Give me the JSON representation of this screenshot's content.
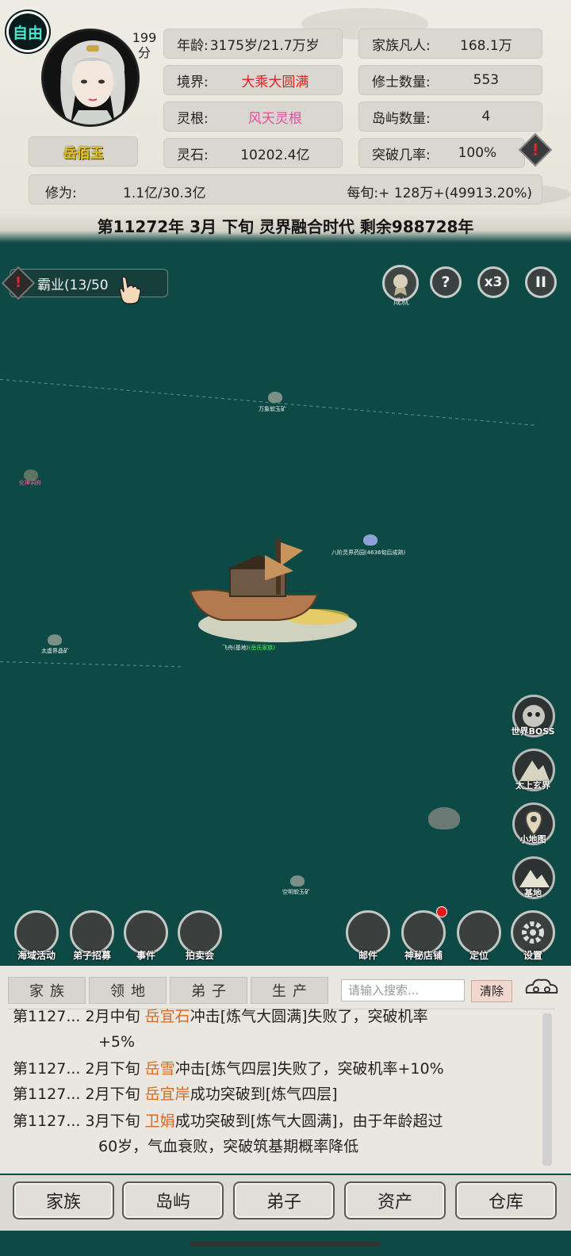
{
  "header": {
    "free_badge": "自由",
    "score_value": "199",
    "score_unit": "分",
    "character_name": "岳佰玉",
    "stats_left": [
      {
        "key": "年龄:",
        "value": "3175岁/21.7万岁",
        "color": "#222222"
      },
      {
        "key": "境界:",
        "value": "大乘大圆满",
        "color": "#e02020"
      },
      {
        "key": "灵根:",
        "value": "风天灵根",
        "color": "#e050a0"
      },
      {
        "key": "灵石:",
        "value": "10202.4亿",
        "color": "#222222"
      }
    ],
    "stats_right": [
      {
        "key": "家族凡人:",
        "value": "168.1万"
      },
      {
        "key": "修士数量:",
        "value": "553"
      },
      {
        "key": "岛屿数量:",
        "value": "4"
      },
      {
        "key": "突破几率:",
        "value": "100%"
      }
    ],
    "cultivation": {
      "key": "修为:",
      "value": "1.1亿/30.3亿",
      "rate": "每旬:+ 128万+(49913.20%)"
    },
    "warn_icon": "!"
  },
  "status_line": "第11272年 3月 下旬  灵界融合时代 剩余988728年",
  "map": {
    "quest_label": "霸业(13/50",
    "quest_warn": "!",
    "achievement_label": "成就",
    "help_label": "?",
    "speed_label": "x3",
    "pause_label": "II",
    "labels": {
      "mine1": "万象软玉矿",
      "farm": "八阶灵界药园(4636旬后成熟)",
      "mine2": "太虚界晶矿",
      "ship": "飞舟(基地)",
      "ship_owner": "(岳氏家族)",
      "mine3": "空明软玉矿",
      "island": "化神洞府"
    },
    "side_buttons": [
      "世界BOSS",
      "太上玄界",
      "小地图",
      "基地"
    ],
    "bottom_left": [
      "海域活动",
      "弟子招募",
      "事件",
      "拍卖会"
    ],
    "bottom_right": [
      "邮件",
      "神秘店铺",
      "定位",
      "设置"
    ]
  },
  "log": {
    "tabs": [
      "家族",
      "领地",
      "弟子",
      "生产"
    ],
    "search_placeholder": "请输入搜索...",
    "clear_label": "清除",
    "entries": [
      {
        "date": "第1127...",
        "time": "2月中旬",
        "name": "岳宜石",
        "text": "冲击[炼气大圆满]失败了，突破机率",
        "cont": "+5%"
      },
      {
        "date": "第1127...",
        "time": "2月下旬",
        "name": "岳雪",
        "text": "冲击[炼气四层]失败了，突破机率+10%"
      },
      {
        "date": "第1127...",
        "time": "2月下旬",
        "name": "岳宜岸",
        "text": "成功突破到[炼气四层]"
      },
      {
        "date": "第1127...",
        "time": "3月下旬",
        "name": "卫娟",
        "text": "成功突破到[炼气大圆满]，由于年龄超过",
        "cont": "60岁，气血衰败，突破筑基期概率降低"
      }
    ]
  },
  "nav": [
    "家族",
    "岛屿",
    "弟子",
    "资产",
    "仓库"
  ]
}
